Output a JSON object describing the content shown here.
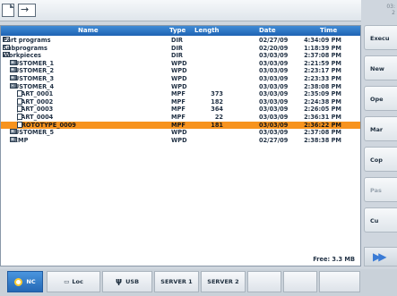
{
  "corner": {
    "line1": "03:",
    "line2": "2"
  },
  "table": {
    "headers": {
      "name": "Name",
      "type": "Type",
      "length": "Length",
      "date": "Date",
      "time": "Time"
    },
    "rows": [
      {
        "indent": 0,
        "exp": "",
        "icon": "folder",
        "name": "Part programs",
        "type": "DIR",
        "length": "",
        "date": "02/27/09",
        "time": "4:34:09 PM"
      },
      {
        "indent": 0,
        "exp": "",
        "icon": "folder",
        "name": "Subprograms",
        "type": "DIR",
        "length": "",
        "date": "02/20/09",
        "time": "1:18:39 PM"
      },
      {
        "indent": 0,
        "exp": "",
        "icon": "folder",
        "name": "Workpieces",
        "type": "DIR",
        "length": "",
        "date": "03/03/09",
        "time": "2:37:08 PM"
      },
      {
        "indent": 1,
        "exp": "+",
        "icon": "folder",
        "name": "CUSTOMER_1",
        "type": "WPD",
        "length": "",
        "date": "03/03/09",
        "time": "2:21:59 PM"
      },
      {
        "indent": 1,
        "exp": "+",
        "icon": "folder",
        "name": "CUSTOMER_2",
        "type": "WPD",
        "length": "",
        "date": "03/03/09",
        "time": "2:23:17 PM"
      },
      {
        "indent": 1,
        "exp": "+",
        "icon": "folder",
        "name": "CUSTOMER_3",
        "type": "WPD",
        "length": "",
        "date": "03/03/09",
        "time": "2:23:33 PM"
      },
      {
        "indent": 1,
        "exp": "-",
        "icon": "folder",
        "name": "CUSTOMER_4",
        "type": "WPD",
        "length": "",
        "date": "03/03/09",
        "time": "2:38:08 PM"
      },
      {
        "indent": 2,
        "exp": "",
        "icon": "file",
        "name": "PART_0001",
        "type": "MPF",
        "length": "373",
        "date": "03/03/09",
        "time": "2:35:09 PM"
      },
      {
        "indent": 2,
        "exp": "",
        "icon": "file",
        "name": "PART_0002",
        "type": "MPF",
        "length": "182",
        "date": "03/03/09",
        "time": "2:24:38 PM"
      },
      {
        "indent": 2,
        "exp": "",
        "icon": "file",
        "name": "PART_0003",
        "type": "MPF",
        "length": "364",
        "date": "03/03/09",
        "time": "2:26:05 PM"
      },
      {
        "indent": 2,
        "exp": "",
        "icon": "file",
        "name": "PART_0004",
        "type": "MPF",
        "length": "22",
        "date": "03/03/09",
        "time": "2:36:31 PM"
      },
      {
        "indent": 2,
        "exp": "",
        "icon": "file",
        "name": "PROTOTYPE_0009",
        "type": "MPF",
        "length": "181",
        "date": "03/03/09",
        "time": "2:36:22 PM",
        "selected": true
      },
      {
        "indent": 1,
        "exp": "+",
        "icon": "folder",
        "name": "CUSTOMER_5",
        "type": "WPD",
        "length": "",
        "date": "03/03/09",
        "time": "2:37:08 PM"
      },
      {
        "indent": 1,
        "exp": "+",
        "icon": "folder",
        "name": "TEMP",
        "type": "WPD",
        "length": "",
        "date": "02/27/09",
        "time": "2:38:38 PM"
      }
    ],
    "free_text": "Free: 3.3 MB"
  },
  "softkeys": [
    {
      "label": "Execu",
      "disabled": false
    },
    {
      "label": "New",
      "disabled": false
    },
    {
      "label": "Ope",
      "disabled": false
    },
    {
      "label": "Mar",
      "disabled": false
    },
    {
      "label": "Cop",
      "disabled": false
    },
    {
      "label": "Pas",
      "disabled": true
    },
    {
      "label": "Cu",
      "disabled": false
    }
  ],
  "bottom_tabs": {
    "nc": "NC",
    "local": "Loc",
    "usb": "USB",
    "server1": "SERVER 1",
    "server2": "SERVER 2"
  },
  "colors": {
    "header": "#1e63b3",
    "selection": "#f7931e",
    "active_tab": "#2468b5"
  }
}
